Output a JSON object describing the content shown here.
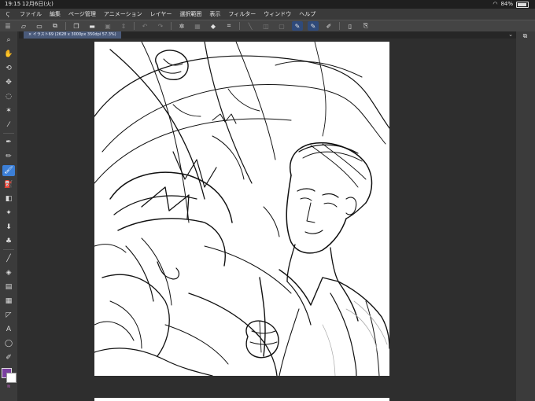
{
  "status": {
    "time": "19:15",
    "date": "12月6日(火)",
    "battery": "84%"
  },
  "menu": {
    "items": [
      "ファイル",
      "編集",
      "ページ管理",
      "アニメーション",
      "レイヤー",
      "選択範囲",
      "表示",
      "フィルター",
      "ウィンドウ",
      "ヘルプ"
    ]
  },
  "document": {
    "tab_label": "イラスト69 (2628 x 3000px 350dpi 57.3%)"
  },
  "colors": {
    "main": "#7a3fa0",
    "sub": "#ffffff",
    "accent": "#3c7fd6"
  }
}
